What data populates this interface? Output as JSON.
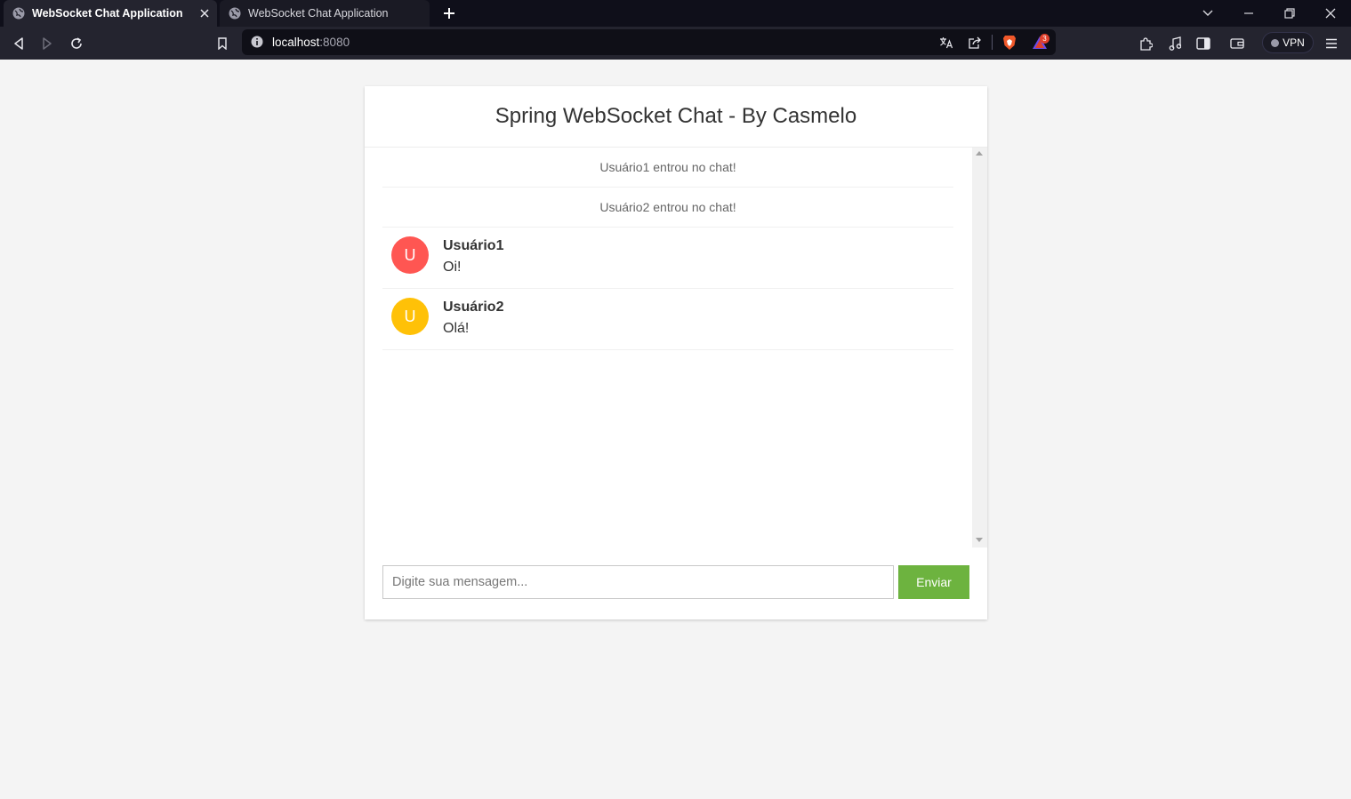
{
  "browser": {
    "tabs": [
      {
        "title": "WebSocket Chat Application",
        "active": true
      },
      {
        "title": "WebSocket Chat Application",
        "active": false
      }
    ],
    "url_host": "localhost",
    "url_port": ":8080",
    "shields_badge": "3",
    "vpn_label": "VPN",
    "icons": [
      "globe-icon",
      "close-icon",
      "plus-icon",
      "chevron-down-icon",
      "minimize-icon",
      "restore-icon",
      "back-icon",
      "forward-icon",
      "reload-icon",
      "bookmark-icon",
      "info-icon",
      "translate-icon",
      "share-icon",
      "brave-shields-icon",
      "brave-rewards-icon",
      "extensions-icon",
      "music-icon",
      "sidebar-icon",
      "wallet-icon",
      "menu-icon"
    ]
  },
  "chat": {
    "title": "Spring WebSocket Chat - By Casmelo",
    "events": [
      {
        "text": "Usuário1 entrou no chat!"
      },
      {
        "text": "Usuário2 entrou no chat!"
      }
    ],
    "messages": [
      {
        "avatar_letter": "U",
        "avatar_color": "#ff5652",
        "sender": "Usuário1",
        "text": "Oi!"
      },
      {
        "avatar_letter": "U",
        "avatar_color": "#ffc107",
        "sender": "Usuário2",
        "text": "Olá!"
      }
    ],
    "input_placeholder": "Digite sua mensagem...",
    "input_value": "",
    "send_label": "Enviar"
  },
  "colors": {
    "page_bg": "#f4f4f4",
    "send_button": "#6db33f",
    "chrome_dark": "#0f0f1a",
    "chrome_toolbar": "#24242f"
  }
}
